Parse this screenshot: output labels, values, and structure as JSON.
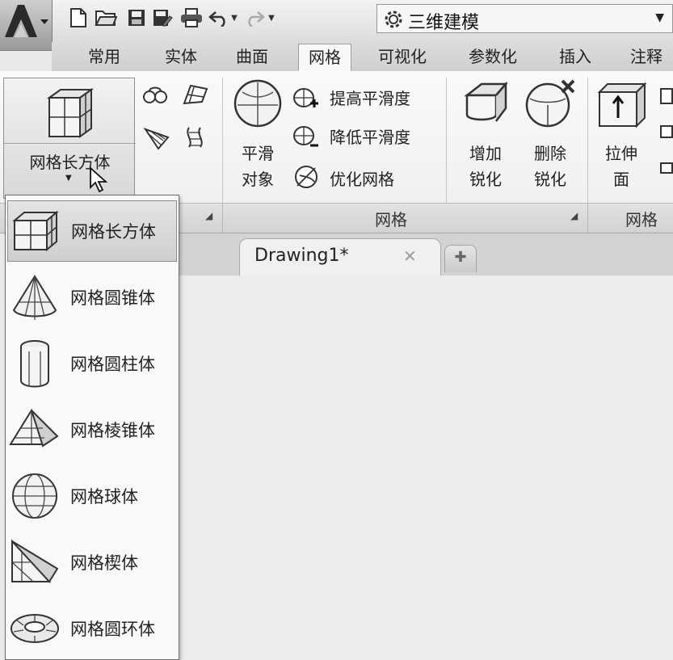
{
  "workspace": {
    "label": "三维建模"
  },
  "tabs": [
    "常用",
    "实体",
    "曲面",
    "网格",
    "可视化",
    "参数化",
    "插入",
    "注释"
  ],
  "active_tab": "网格",
  "ribbon": {
    "primitive_button": "网格长方体",
    "smooth_object": [
      "平滑",
      "对象"
    ],
    "raise_smoothness": "提高平滑度",
    "lower_smoothness": "降低平滑度",
    "refine_mesh": "优化网格",
    "add_crease": [
      "增加",
      "锐化"
    ],
    "remove_crease": [
      "删除",
      "锐化"
    ],
    "extrude_face": [
      "拉伸",
      "面"
    ],
    "panel_title_mesh": "网格",
    "panel_title_edit": "网格编"
  },
  "document": {
    "tab_label": "Drawing1*",
    "close_glyph": "✕",
    "new_tab_glyph": "✚"
  },
  "dropdown": {
    "items": [
      "网格长方体",
      "网格圆锥体",
      "网格圆柱体",
      "网格棱锥体",
      "网格球体",
      "网格楔体",
      "网格圆环体"
    ],
    "selected": "网格长方体"
  }
}
